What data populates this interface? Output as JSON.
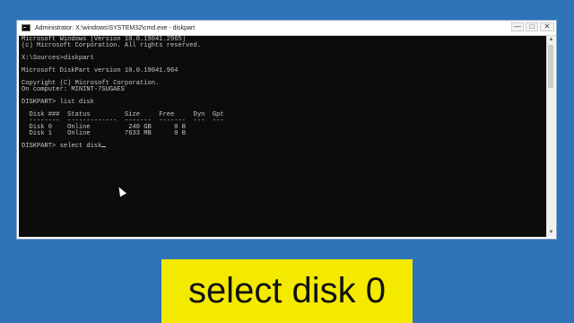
{
  "window": {
    "title": "Administrator: X:\\windows\\SYSTEM32\\cmd.exe - diskpart",
    "controls": {
      "minimize": "—",
      "maximize": "□",
      "close": "✕"
    }
  },
  "console_lines": [
    "Microsoft Windows [Version 10.0.19041.2965]",
    "(c) Microsoft Corporation. All rights reserved.",
    "",
    "X:\\Sources>diskpart",
    "",
    "Microsoft DiskPart version 10.0.19041.964",
    "",
    "Copyright (C) Microsoft Corporation.",
    "On computer: MININT-7SUGAES",
    "",
    "DISKPART> list disk",
    "",
    "  Disk ###  Status         Size     Free     Dyn  Gpt",
    "  --------  -------------  -------  -------  ---  ---",
    "  Disk 0    Online          240 GB      0 B",
    "  Disk 1    Online         7633 MB      0 B",
    "",
    "DISKPART> select disk"
  ],
  "caption": "select disk 0"
}
